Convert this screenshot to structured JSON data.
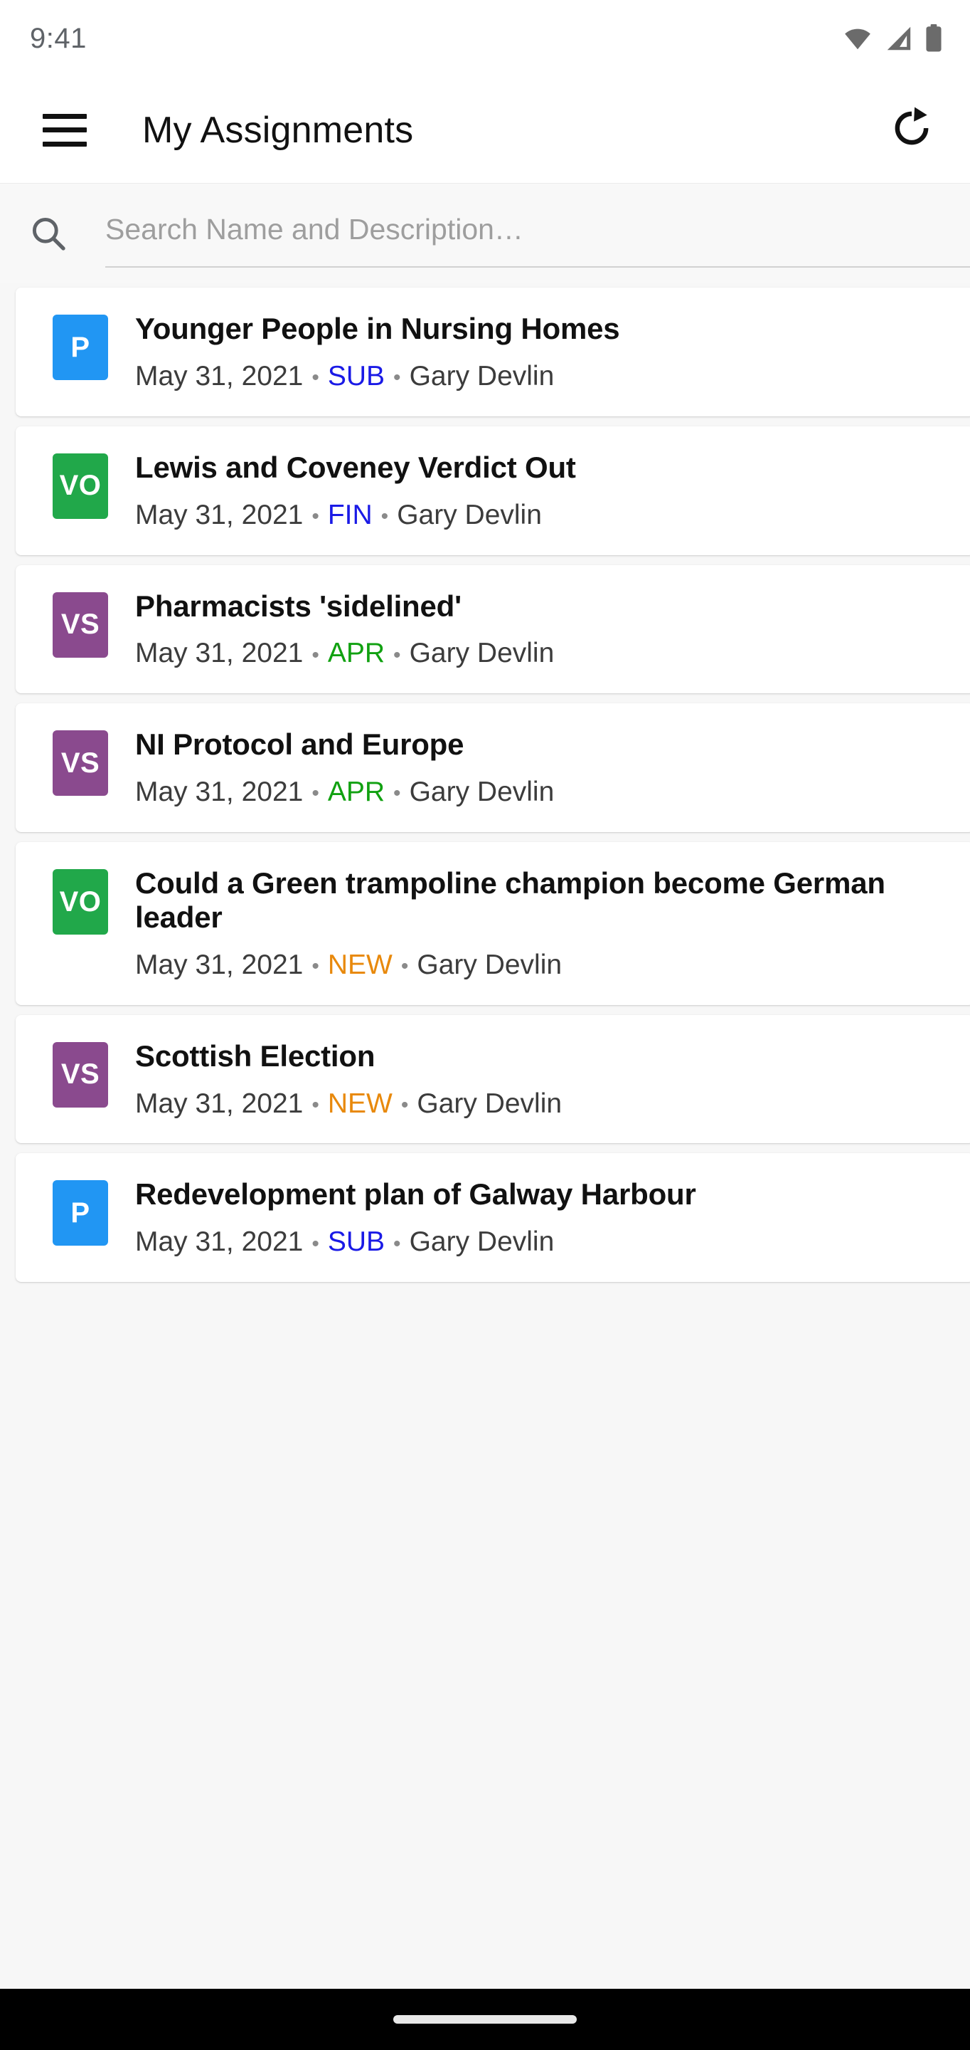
{
  "status_bar": {
    "time": "9:41",
    "icons": [
      "wifi-icon",
      "cellular-signal-icon",
      "battery-icon"
    ]
  },
  "app_bar": {
    "menu_icon": "hamburger-menu-icon",
    "title": "My Assignments",
    "action_icon": "refresh-icon"
  },
  "search": {
    "icon": "search-icon",
    "value": "",
    "placeholder": "Search Name and Description…"
  },
  "colors": {
    "badge_blue": "#2196f3",
    "badge_green": "#21a84a",
    "badge_purple": "#8a4a8e",
    "status_blue": "#1a1ae6",
    "status_green": "#11a111",
    "status_orange": "#e8890c",
    "page_background": "#f7f7f7",
    "card_background": "#ffffff"
  },
  "assignments": [
    {
      "badge": "P",
      "badge_color": "#2196f3",
      "title": "Younger People in Nursing Homes",
      "date": "May 31, 2021",
      "status": "SUB",
      "status_color": "#1a1ae6",
      "author": "Gary Devlin"
    },
    {
      "badge": "VO",
      "badge_color": "#21a84a",
      "title": "Lewis and Coveney Verdict Out",
      "date": "May 31, 2021",
      "status": "FIN",
      "status_color": "#1a1ae6",
      "author": "Gary Devlin"
    },
    {
      "badge": "VS",
      "badge_color": "#8a4a8e",
      "title": "Pharmacists 'sidelined'",
      "date": "May 31, 2021",
      "status": "APR",
      "status_color": "#11a111",
      "author": "Gary Devlin"
    },
    {
      "badge": "VS",
      "badge_color": "#8a4a8e",
      "title": "NI Protocol and Europe",
      "date": "May 31, 2021",
      "status": "APR",
      "status_color": "#11a111",
      "author": "Gary Devlin"
    },
    {
      "badge": "VO",
      "badge_color": "#21a84a",
      "title": "Could a Green trampoline champion become German leader",
      "date": "May 31, 2021",
      "status": "NEW",
      "status_color": "#e8890c",
      "author": "Gary Devlin"
    },
    {
      "badge": "VS",
      "badge_color": "#8a4a8e",
      "title": "Scottish Election",
      "date": "May 31, 2021",
      "status": "NEW",
      "status_color": "#e8890c",
      "author": "Gary Devlin"
    },
    {
      "badge": "P",
      "badge_color": "#2196f3",
      "title": "Redevelopment plan of Galway Harbour",
      "date": "May 31, 2021",
      "status": "SUB",
      "status_color": "#1a1ae6",
      "author": "Gary Devlin"
    }
  ],
  "separator": "•",
  "nav_bar": {
    "handle": "gesture-pill"
  }
}
